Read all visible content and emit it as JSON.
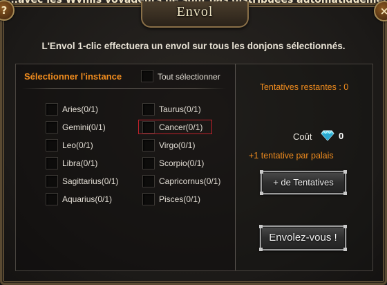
{
  "notice": "...avec les Wynlis voyageurs ne sont pas distribuées automatiquement. Venir",
  "window": {
    "title": "Envol",
    "help_glyph": "?",
    "close_glyph": "×"
  },
  "intro": "L'Envol 1-clic effectuera un envol sur tous les donjons sélectionnés.",
  "left": {
    "header": "Sélectionner l'instance",
    "select_all": "Tout sélectionner",
    "dungeons": [
      {
        "label": "Aries(0/1)"
      },
      {
        "label": "Taurus(0/1)"
      },
      {
        "label": "Gemini(0/1)"
      },
      {
        "label": "Cancer(0/1)"
      },
      {
        "label": "Leo(0/1)"
      },
      {
        "label": "Virgo(0/1)"
      },
      {
        "label": "Libra(0/1)"
      },
      {
        "label": "Scorpio(0/1)"
      },
      {
        "label": "Sagittarius(0/1)"
      },
      {
        "label": "Capricornus(0/1)"
      },
      {
        "label": "Aquarius(0/1)"
      },
      {
        "label": "Pisces(0/1)"
      }
    ],
    "highlighted": "Cancer(0/1)"
  },
  "right": {
    "attempts": "Tentatives restantes : 0",
    "cost_label": "Coût",
    "cost_value": "0",
    "cost_icon": "diamond-icon",
    "bonus": "+1 tentative par palais",
    "more_button": "+ de Tentatives",
    "fly_button": "Envolez-vous !"
  },
  "colors": {
    "accent_orange": "#f08c1e",
    "highlight_red": "#c0212b",
    "gem_cyan": "#5ad8f0"
  }
}
